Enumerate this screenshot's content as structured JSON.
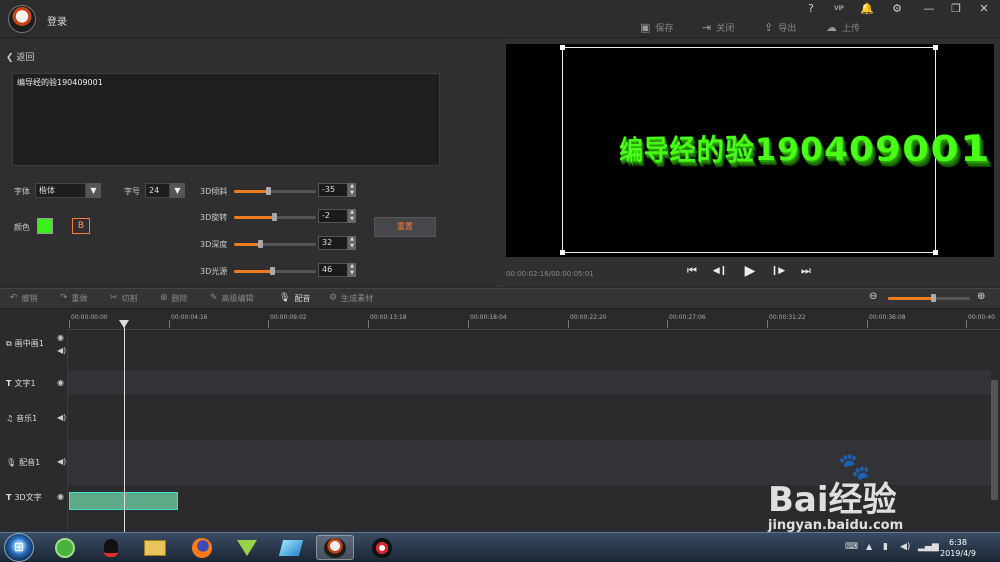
{
  "window": {
    "login": "登录",
    "controls": [
      "?",
      "VIP",
      "🔔",
      "⚙",
      "—",
      "❐",
      "✕"
    ],
    "actions": [
      {
        "icon": "save-icon",
        "label": "保存"
      },
      {
        "icon": "close-doc-icon",
        "label": "关闭"
      },
      {
        "icon": "export-icon",
        "label": "导出"
      },
      {
        "icon": "upload-icon",
        "label": "上传"
      }
    ]
  },
  "editor": {
    "back_label": "返回",
    "text_value": "编导经的验190409001",
    "font_label": "字体",
    "font_value": "楷体",
    "size_label": "字号",
    "size_value": "24",
    "color_label": "颜色",
    "color_hex": "#3bf01a",
    "bold_label": "B",
    "sliders": [
      {
        "label": "3D倾斜",
        "value": "-35",
        "fraction": 0.42
      },
      {
        "label": "3D旋转",
        "value": "-2",
        "fraction": 0.49
      },
      {
        "label": "3D深度",
        "value": "32",
        "fraction": 0.32
      },
      {
        "label": "3D光源",
        "value": "46",
        "fraction": 0.46
      }
    ],
    "reset_label": "重置"
  },
  "preview": {
    "text": "编导经的验190409001",
    "timecode": "00:00:02:16/00:00:05:01",
    "buttons": [
      "⏮",
      "◀❙",
      "▶",
      "❙▶",
      "⏭"
    ]
  },
  "toolbar": {
    "tools": [
      {
        "icon": "undo-icon",
        "label": "撤销",
        "active": false
      },
      {
        "icon": "redo-icon",
        "label": "重做",
        "active": false
      },
      {
        "icon": "cut-icon",
        "label": "切割",
        "active": false
      },
      {
        "icon": "delete-icon",
        "label": "删除",
        "active": false
      },
      {
        "icon": "advanced-edit-icon",
        "label": "高级编辑",
        "active": false
      },
      {
        "icon": "microphone-icon",
        "label": "配音",
        "active": true
      },
      {
        "icon": "generate-icon",
        "label": "生成素材",
        "active": false
      }
    ],
    "zoom_fraction": 0.55
  },
  "timeline": {
    "ticks": [
      "00:00:00:00",
      "00:00:04:16",
      "00:00:09:02",
      "00:00:13:18",
      "00:00:18:04",
      "00:00:22:20",
      "00:00:27:06",
      "00:00:31:22",
      "00:00:36:08",
      "00:00:40"
    ],
    "tracks": [
      {
        "icon": "picture-in-picture-icon",
        "label": "画中画1"
      },
      {
        "icon": "text-icon",
        "label": "文字1"
      },
      {
        "icon": "music-icon",
        "label": "音乐1"
      },
      {
        "icon": "microphone-icon",
        "label": "配音1"
      },
      {
        "icon": "text-icon",
        "label": "3D文字"
      }
    ]
  },
  "taskbar": {
    "time": "6:38",
    "date": "2019/4/9"
  },
  "watermark": {
    "brand": "Bai经验",
    "url": "jingyan.baidu.com"
  }
}
